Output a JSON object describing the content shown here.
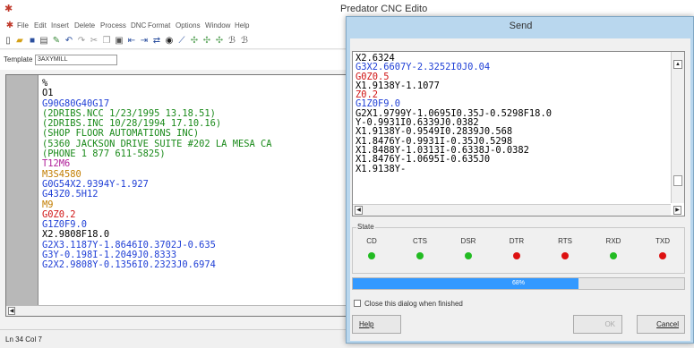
{
  "main": {
    "title": "Predator CNC Edito",
    "menu": [
      "File",
      "Edit",
      "Insert",
      "Delete",
      "Process",
      "DNC",
      "Format",
      "Options",
      "Window",
      "Help"
    ],
    "template_label": "Template",
    "template_value": "3AXYMILL",
    "status": "Ln 34 Col 7",
    "lines": [
      {
        "t": "%",
        "c": "#000000"
      },
      {
        "t": "O1",
        "c": "#000000"
      },
      {
        "t": "G90G80G40G17",
        "c": "#1f3fd6"
      },
      {
        "t": "(2DRIBS.NCC 1/23/1995 13.18.51)",
        "c": "#1a8a1a"
      },
      {
        "t": "(2DRIBS.INC 10/28/1994 17.10.16)",
        "c": "#1a8a1a"
      },
      {
        "t": "(SHOP FLOOR AUTOMATIONS INC)",
        "c": "#1a8a1a"
      },
      {
        "t": "(5360 JACKSON DRIVE SUITE #202 LA MESA CA",
        "c": "#1a8a1a"
      },
      {
        "t": "(PHONE 1 877 611-5825)",
        "c": "#1a8a1a"
      },
      {
        "t": "T12M6",
        "c": "#b0209a"
      },
      {
        "t": "M3S4580",
        "c": "#c27d00"
      },
      {
        "t": "G0G54X2.9394Y-1.927",
        "c": "#1f3fd6"
      },
      {
        "t": "G43Z0.5H12",
        "c": "#1f3fd6"
      },
      {
        "t": "M9",
        "c": "#c27d00"
      },
      {
        "t": "G0Z0.2",
        "c": "#d01414"
      },
      {
        "t": "G1Z0F9.0",
        "c": "#1f3fd6"
      },
      {
        "t": "X2.9808F18.0",
        "c": "#000000"
      },
      {
        "t": "G2X3.1187Y-1.8646I0.3702J-0.635",
        "c": "#1f3fd6"
      },
      {
        "t": "G3Y-0.198I-1.2049J0.8333",
        "c": "#1f3fd6"
      },
      {
        "t": "G2X2.9808Y-0.1356I0.2323J0.6974",
        "c": "#1f3fd6"
      }
    ]
  },
  "dialog": {
    "title": "Send",
    "lines": [
      {
        "t": "X2.6324",
        "c": "#000000"
      },
      {
        "t": "G3X2.6607Y-2.3252I0J0.04",
        "c": "#1f3fd6"
      },
      {
        "t": "G0Z0.5",
        "c": "#d01414"
      },
      {
        "t": "X1.9138Y-1.1077",
        "c": "#000000"
      },
      {
        "t": "Z0.2",
        "c": "#d01414"
      },
      {
        "t": "G1Z0F9.0",
        "c": "#1f3fd6"
      },
      {
        "t": "G2X1.9799Y-1.0695I0.35J-0.5298F18.0",
        "c": "#000000"
      },
      {
        "t": "Y-0.9931I0.6339J0.0382",
        "c": "#000000"
      },
      {
        "t": "X1.9138Y-0.9549I0.2839J0.568",
        "c": "#000000"
      },
      {
        "t": "X1.8476Y-0.9931I-0.35J0.5298",
        "c": "#000000"
      },
      {
        "t": "X1.8488Y-1.0313I-0.6338J-0.0382",
        "c": "#000000"
      },
      {
        "t": "X1.8476Y-1.0695I-0.635J0",
        "c": "#000000"
      },
      {
        "t": "X1.9138Y-",
        "c": "#000000"
      }
    ],
    "state_label": "State",
    "signals": [
      {
        "name": "CD",
        "color": "#22bb22"
      },
      {
        "name": "CTS",
        "color": "#22bb22"
      },
      {
        "name": "DSR",
        "color": "#22bb22"
      },
      {
        "name": "DTR",
        "color": "#dd1111"
      },
      {
        "name": "RTS",
        "color": "#dd1111"
      },
      {
        "name": "RXD",
        "color": "#22bb22"
      },
      {
        "name": "TXD",
        "color": "#dd1111"
      }
    ],
    "progress": {
      "value": 68,
      "label": "68%"
    },
    "close_checkbox_label": "Close this dialog when finished",
    "help_label": "Help",
    "ok_label": "OK",
    "cancel_label": "Cancel"
  }
}
